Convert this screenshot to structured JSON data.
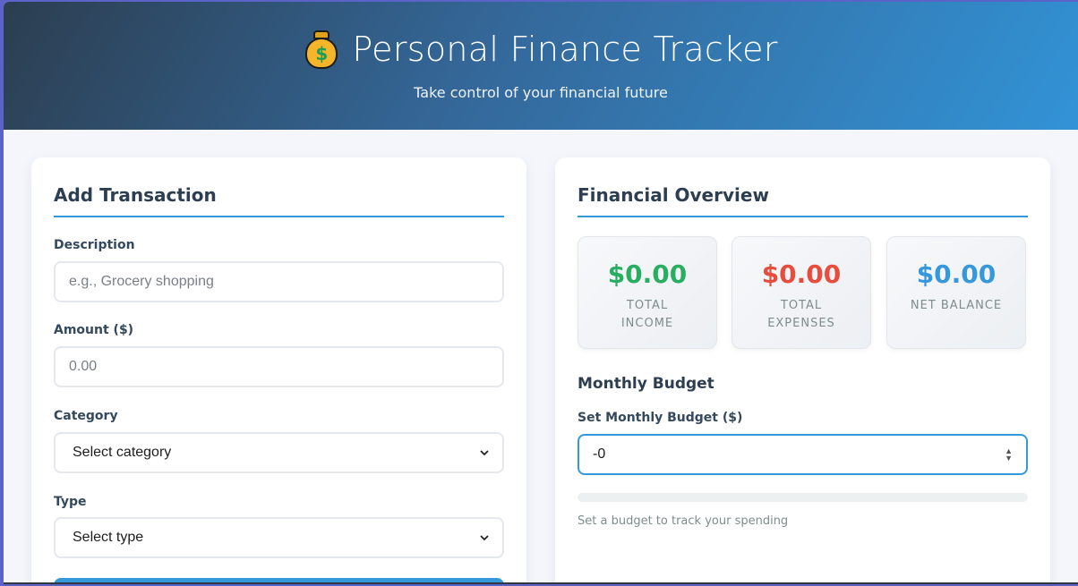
{
  "header": {
    "icon": "money-bag-icon",
    "title": "Personal Finance Tracker",
    "subtitle": "Take control of your financial future"
  },
  "add_transaction": {
    "heading": "Add Transaction",
    "description": {
      "label": "Description",
      "placeholder": "e.g., Grocery shopping",
      "value": ""
    },
    "amount": {
      "label": "Amount ($)",
      "placeholder": "0.00",
      "value": ""
    },
    "category": {
      "label": "Category",
      "selected": "Select category"
    },
    "type": {
      "label": "Type",
      "selected": "Select type"
    }
  },
  "overview": {
    "heading": "Financial Overview",
    "stats": [
      {
        "amount": "$0.00",
        "caption": "TOTAL INCOME",
        "color": "#27ae60"
      },
      {
        "amount": "$0.00",
        "caption": "TOTAL EXPENSES",
        "color": "#e74c3c"
      },
      {
        "amount": "$0.00",
        "caption": "NET BALANCE",
        "color": "#3498db"
      }
    ],
    "budget": {
      "heading": "Monthly Budget",
      "label": "Set Monthly Budget ($)",
      "value": "-0",
      "progress": 0,
      "hint": "Set a budget to track your spending"
    }
  }
}
